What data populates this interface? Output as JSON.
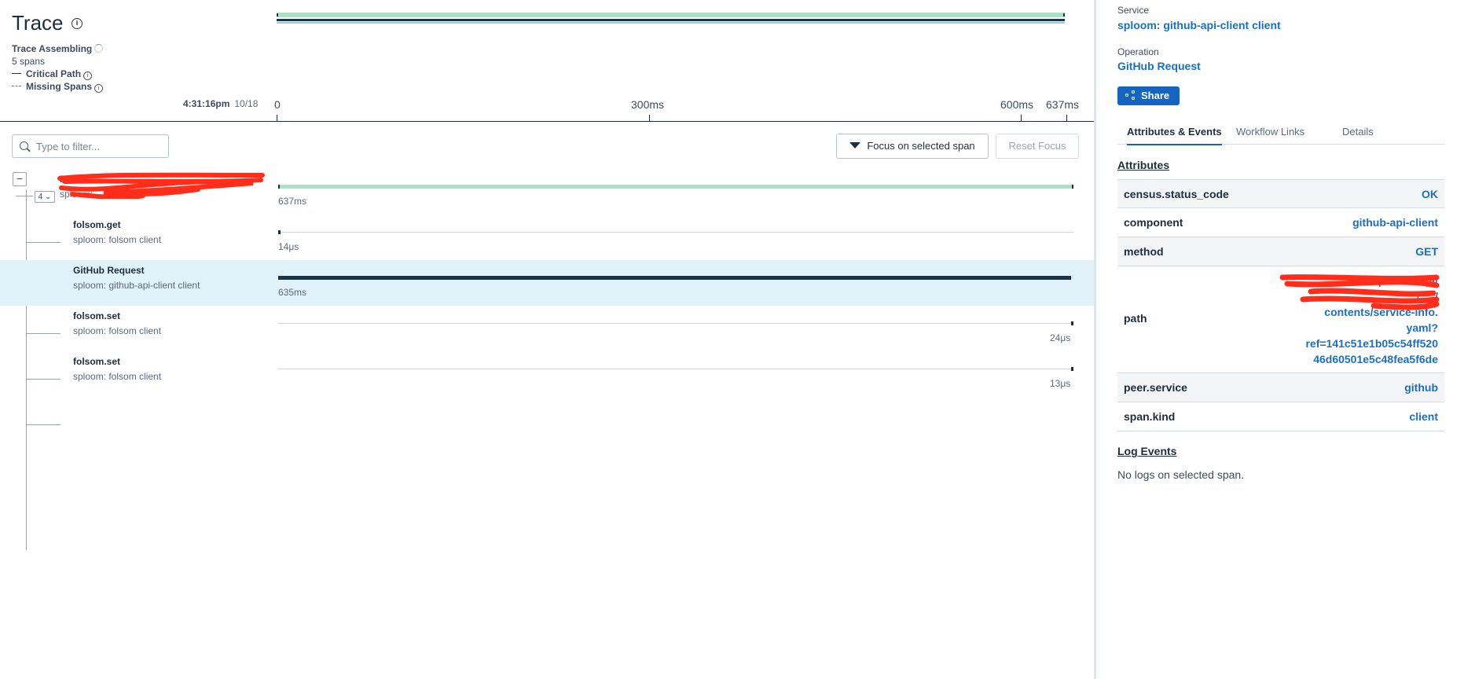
{
  "header": {
    "title": "Trace",
    "status": "Trace Assembling",
    "span_count": "5 spans",
    "legend_critical": "Critical Path",
    "legend_missing": "Missing Spans"
  },
  "timeline": {
    "clock": "4:31:16pm",
    "date": "10/18",
    "ticks": [
      "0",
      "300ms",
      "600ms",
      "637ms"
    ]
  },
  "toolbar": {
    "filter_placeholder": "Type to filter...",
    "focus_label": "Focus on selected span",
    "reset_label": "Reset Focus"
  },
  "spans": [
    {
      "name": "Recv./...",
      "service": "sploom: ...",
      "duration": "637ms",
      "child_count": "4",
      "bar_start": 0.0,
      "bar_fraction": 1.0,
      "color": "#a7e3c4",
      "redacted": true
    },
    {
      "name": "folsom.get",
      "service": "sploom: folsom client",
      "duration": "14μs",
      "bar_start": 0.0,
      "bar_fraction": 0.0,
      "color": "#1f2d3d"
    },
    {
      "name": "GitHub Request",
      "service": "sploom: github-api-client client",
      "duration": "635ms",
      "bar_start": 0.0,
      "bar_fraction": 0.997,
      "color": "#17354d",
      "selected": true
    },
    {
      "name": "folsom.set",
      "service": "sploom: folsom client",
      "duration": "24μs",
      "bar_start": 0.999,
      "bar_fraction": 0.0,
      "color": "#1f2d3d"
    },
    {
      "name": "folsom.set",
      "service": "sploom: folsom client",
      "duration": "13μs",
      "bar_start": 0.999,
      "bar_fraction": 0.0,
      "color": "#1f2d3d"
    }
  ],
  "details": {
    "service_label": "Service",
    "service_value": "sploom: github-api-client client",
    "operation_label": "Operation",
    "operation_value": "GitHub Request",
    "share_label": "Share",
    "tabs": [
      "Attributes & Events",
      "Workflow Links",
      "Details"
    ],
    "attributes_title": "Attributes",
    "attributes": [
      {
        "key": "census.status_code",
        "value": "OK"
      },
      {
        "key": "component",
        "value": "github-api-client"
      },
      {
        "key": "method",
        "value": "GET"
      },
      {
        "key": "path",
        "value_lines": [
          "https://...../api/",
          "....../...../",
          "contents/service-info.",
          "yaml?",
          "ref=141c51e1b05c54ff520",
          "46d60501e5c48fea5f6de"
        ]
      },
      {
        "key": "peer.service",
        "value": "github"
      },
      {
        "key": "span.kind",
        "value": "client"
      }
    ],
    "log_events_title": "Log Events",
    "no_logs": "No logs on selected span."
  },
  "colors": {
    "accent": "#1565c0",
    "link": "#1a6fc0",
    "selected_row": "#e1f2fa",
    "root_bar": "#a7e3c4",
    "critical": "#17354d",
    "missing": "#e04a2b"
  }
}
